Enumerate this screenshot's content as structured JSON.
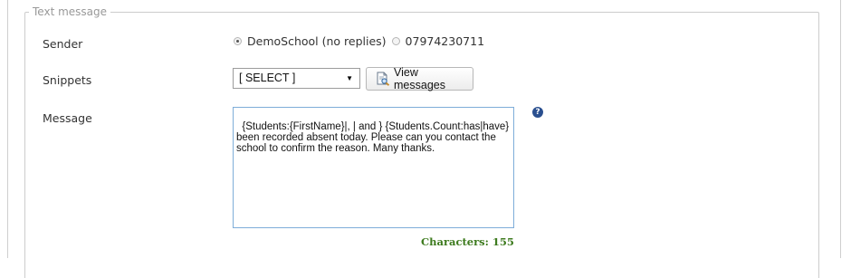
{
  "fieldset": {
    "legend": "Text message"
  },
  "sender": {
    "label": "Sender",
    "options": [
      {
        "label": "DemoSchool (no replies)",
        "selected": true
      },
      {
        "label": "07974230711",
        "selected": false
      }
    ]
  },
  "snippets": {
    "label": "Snippets",
    "select_value": "[ SELECT ]",
    "view_button_label": "View messages"
  },
  "message": {
    "label": "Message",
    "text": "{Students:{FirstName}|, | and } {Students.Count:has|have}\nbeen recorded absent today. Please can you contact the\nschool to confirm the reason. Many thanks.",
    "counter": "Characters: 155",
    "help_icon": "question-icon"
  },
  "colors": {
    "accent_border": "#7eadd9",
    "counter_green": "#3c7a1d",
    "help_blue": "#2a4f8f"
  }
}
